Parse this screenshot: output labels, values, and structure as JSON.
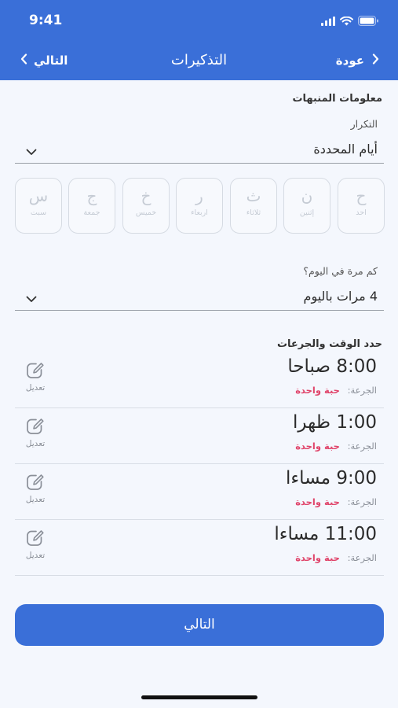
{
  "status_bar": {
    "time": "9:41"
  },
  "nav": {
    "title": "التذكيرات",
    "back_label": "عودة",
    "next_label": "التالي"
  },
  "alerts_section": {
    "title": "معلومات المنبهات",
    "repeat_label": "التكرار",
    "repeat_value": "أيام المحددة",
    "days": [
      {
        "letter": "ح",
        "name": "احد"
      },
      {
        "letter": "ن",
        "name": "إثنين"
      },
      {
        "letter": "ث",
        "name": "ثلاثاء"
      },
      {
        "letter": "ر",
        "name": "اربعاء"
      },
      {
        "letter": "خ",
        "name": "خميس"
      },
      {
        "letter": "ج",
        "name": "جمعة"
      },
      {
        "letter": "س",
        "name": "سبت"
      }
    ],
    "times_per_day_label": "كم مرة في اليوم؟",
    "times_per_day_value": "4 مرات باليوم"
  },
  "doses_section": {
    "title": "حدد الوقت والجرعات",
    "dose_label": "الجرعة:",
    "edit_label": "تعديل",
    "items": [
      {
        "time": "8:00 صباحا",
        "dose": "حبة واحدة"
      },
      {
        "time": "1:00 ظهرا",
        "dose": "حبة واحدة"
      },
      {
        "time": "9:00 مساءا",
        "dose": "حبة واحدة"
      },
      {
        "time": "11:00 مساءا",
        "dose": "حبة واحدة"
      }
    ]
  },
  "footer": {
    "next_button": "التالي"
  },
  "colors": {
    "primary": "#3a6fd8",
    "dose_accent": "#e0456b",
    "background": "#f4f7fd"
  }
}
